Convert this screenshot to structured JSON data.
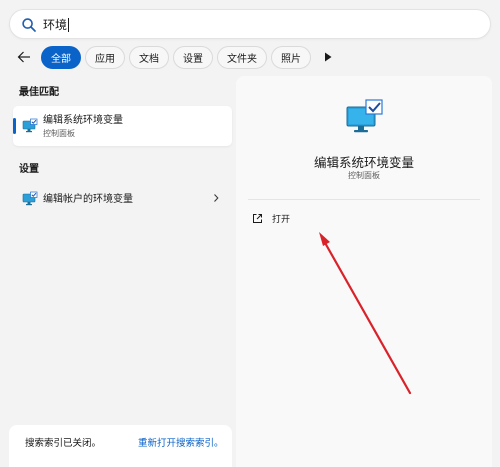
{
  "search": {
    "query": "环境"
  },
  "filters": [
    {
      "label": "全部",
      "active": true
    },
    {
      "label": "应用",
      "active": false
    },
    {
      "label": "文档",
      "active": false
    },
    {
      "label": "设置",
      "active": false
    },
    {
      "label": "文件夹",
      "active": false
    },
    {
      "label": "照片",
      "active": false
    }
  ],
  "best_match": {
    "heading": "最佳匹配",
    "title": "编辑系统环境变量",
    "subtitle": "控制面板",
    "icon": "system-properties-icon"
  },
  "settings_section": {
    "heading": "设置",
    "title": "编辑帐户的环境变量",
    "icon": "system-properties-icon"
  },
  "detail": {
    "title": "编辑系统环境变量",
    "subtitle": "控制面板",
    "open_label": "打开",
    "icon": "system-properties-icon"
  },
  "status": {
    "text": "搜索索引已关闭。",
    "link": "重新打开搜索索引。"
  },
  "colors": {
    "accent": "#0a63c9",
    "annotation_arrow": "#d9232a"
  }
}
